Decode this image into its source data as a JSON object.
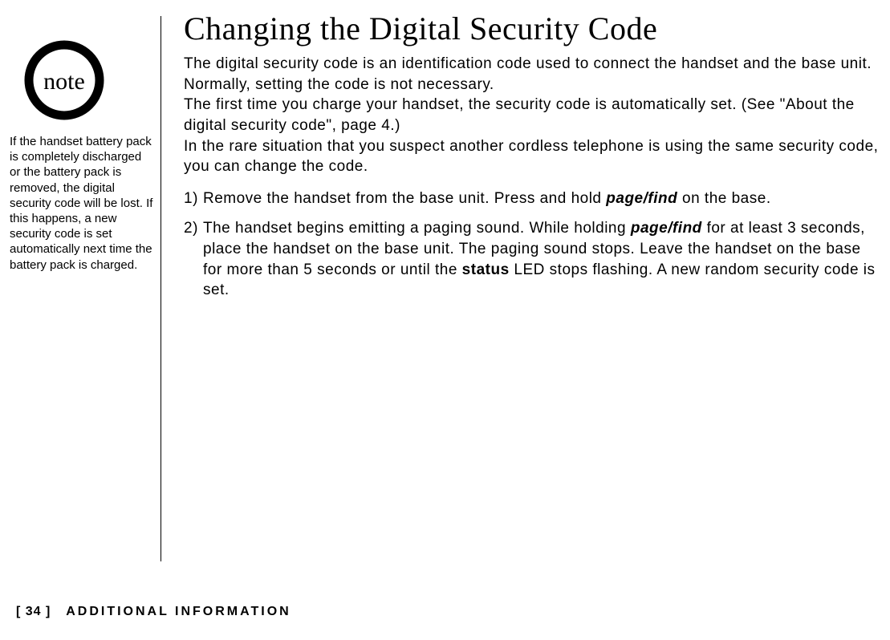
{
  "sidebar": {
    "note_label": "note",
    "note_body": "If the handset battery pack is completely discharged or the battery pack is removed, the digital security code will be lost. If this happens, a new security code is set automatically next time the battery pack is charged."
  },
  "main": {
    "title": "Changing the Digital Security Code",
    "intro": {
      "p1": "The digital security code is an identification code used to connect the handset and the base unit. Normally, setting the code is not necessary.",
      "p2a": "The first time you charge your handset, the security code is automatically set. (See \"About the digital security code\", page ",
      "p2_ref": "4",
      "p2b": ".)",
      "p3": "In the rare situation that you suspect another cordless telephone is using the same security code, you can change the code."
    },
    "steps": [
      {
        "num": "1)",
        "text_before": "Remove the handset from the base unit. Press and hold ",
        "pagefind": "page/find",
        "text_after": " on the base."
      },
      {
        "num": "2)",
        "text_a": "The handset begins emitting a paging sound. While holding ",
        "pagefind": "page/find",
        "text_b": " for at least 3 seconds, place the handset on the base unit. The paging sound stops. Leave the handset on the base for more than 5 seconds or until the ",
        "status": "status",
        "text_c": " LED stops flashing. A new random security code is set."
      }
    ]
  },
  "footer": {
    "page_number": "[ 34 ]",
    "section": "ADDITIONAL INFORMATION"
  }
}
